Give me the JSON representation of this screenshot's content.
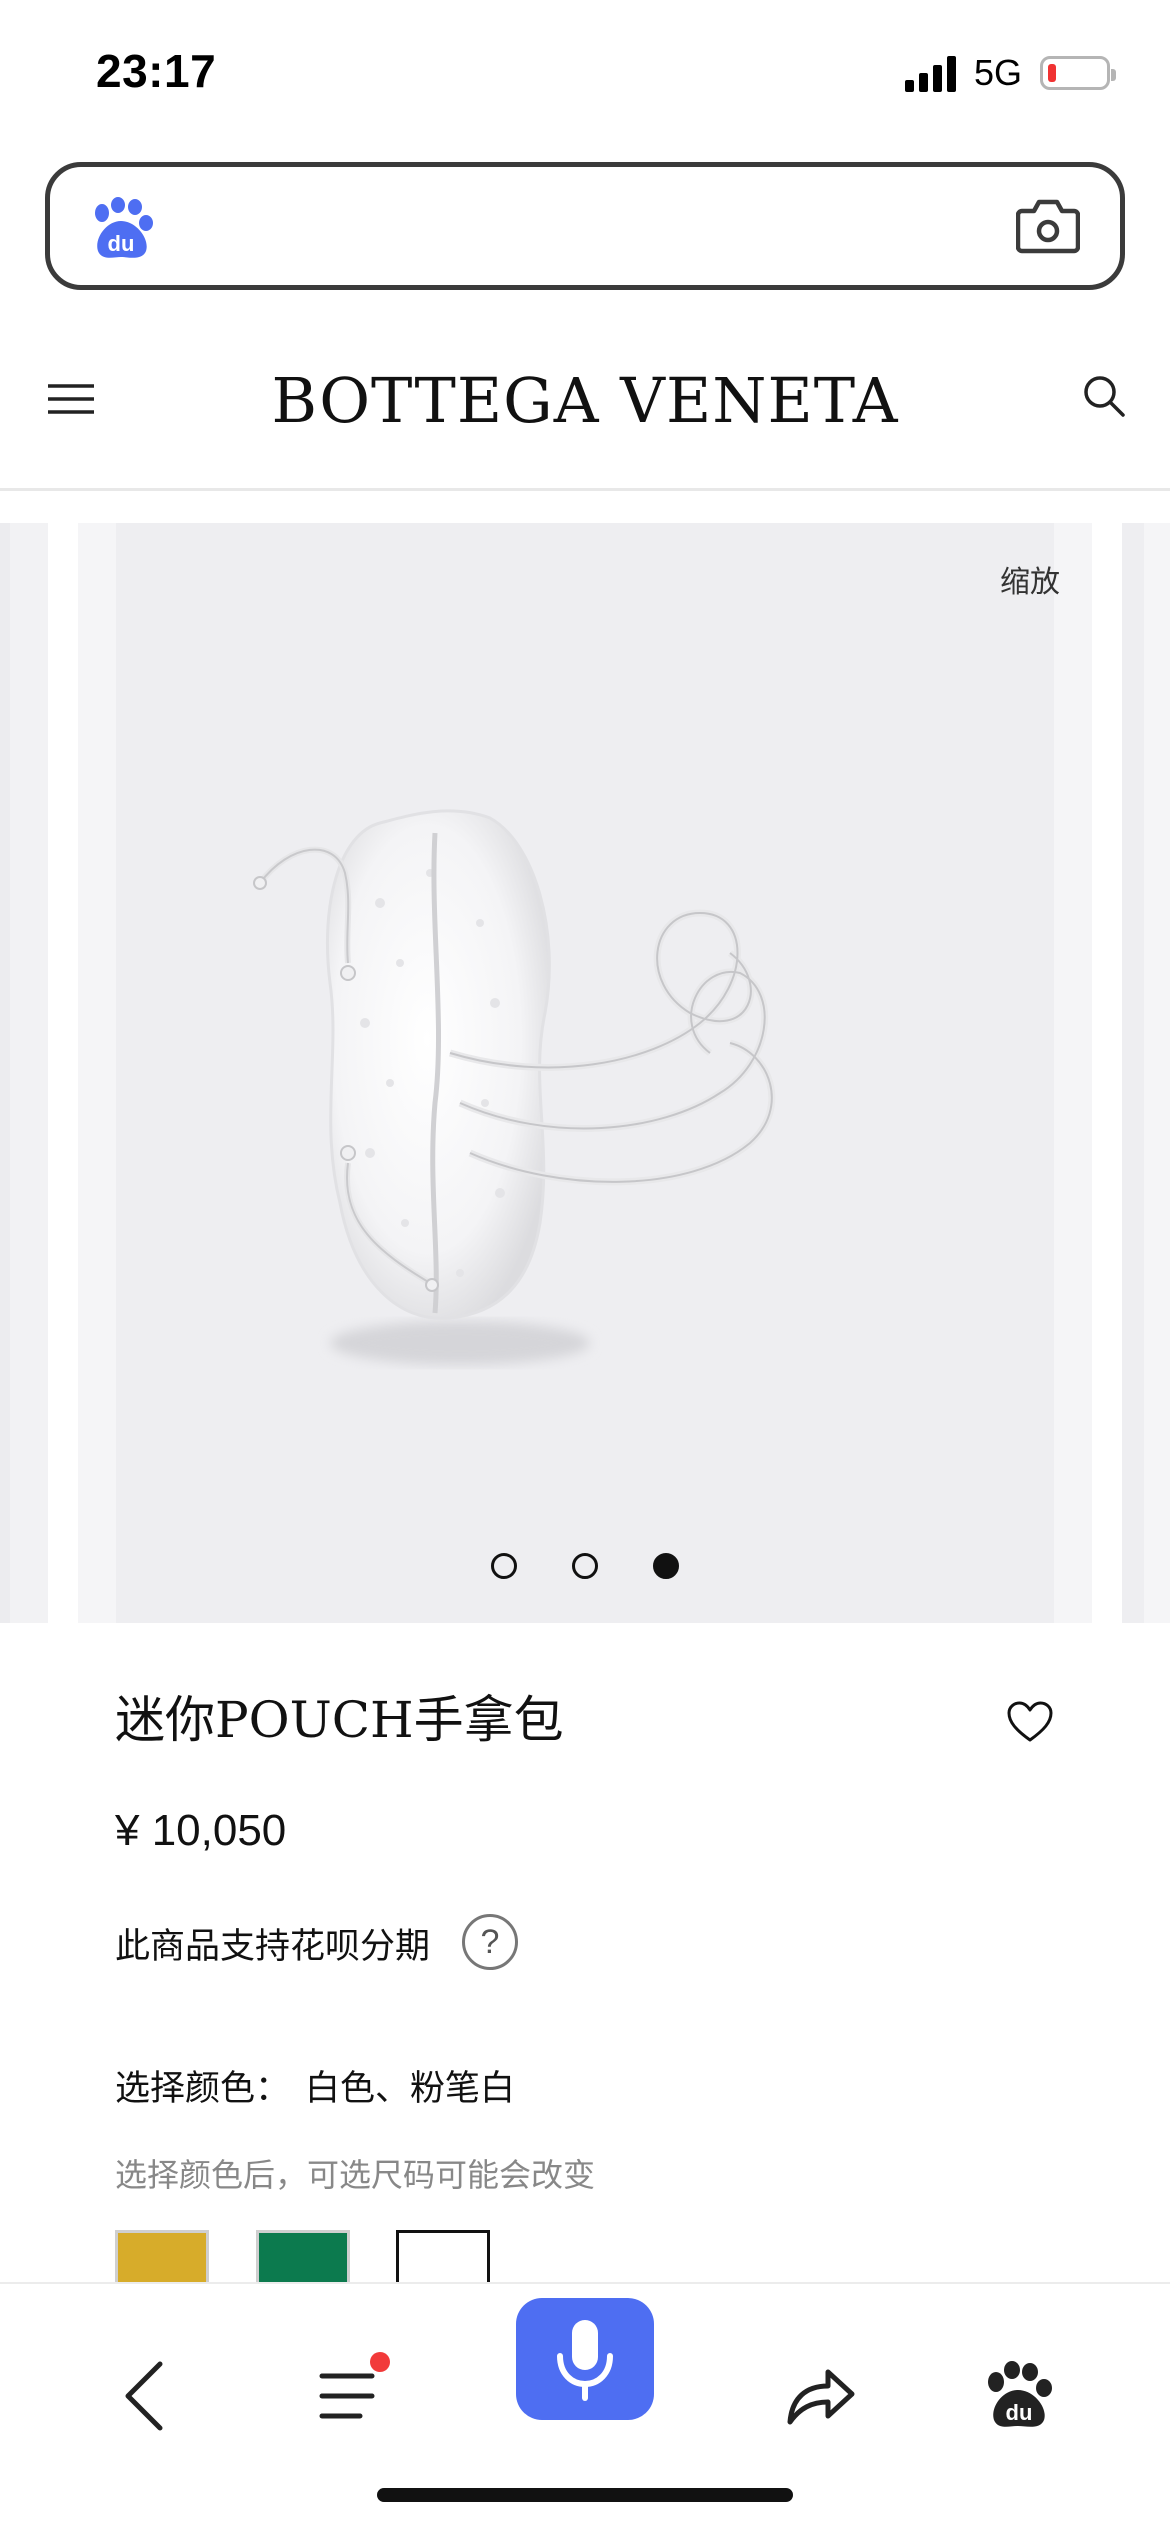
{
  "status_bar": {
    "time": "23:17",
    "network": "5G"
  },
  "search": {
    "placeholder": "",
    "value": ""
  },
  "site": {
    "brand": "BOTTEGA VENETA"
  },
  "carousel": {
    "zoom_label": "缩放",
    "slide_count": 3,
    "active_index": 2
  },
  "product": {
    "title": "迷你POUCH手拿包",
    "price": "¥ 10,050",
    "installment_text": "此商品支持花呗分期",
    "help_symbol": "?",
    "color_label": "选择颜色：",
    "color_value": "白色、粉笔白",
    "color_hint": "选择颜色后，可选尺码可能会改变",
    "swatches": [
      "#d7ac2a",
      "#0c7a4e",
      "#ffffff"
    ]
  },
  "colors": {
    "accent": "#4e6ef2",
    "notification": "#f23a3a"
  },
  "toolbar": {
    "icons": [
      "back-icon",
      "menu-icon",
      "microphone-icon",
      "share-icon",
      "baidu-paw-icon"
    ]
  }
}
